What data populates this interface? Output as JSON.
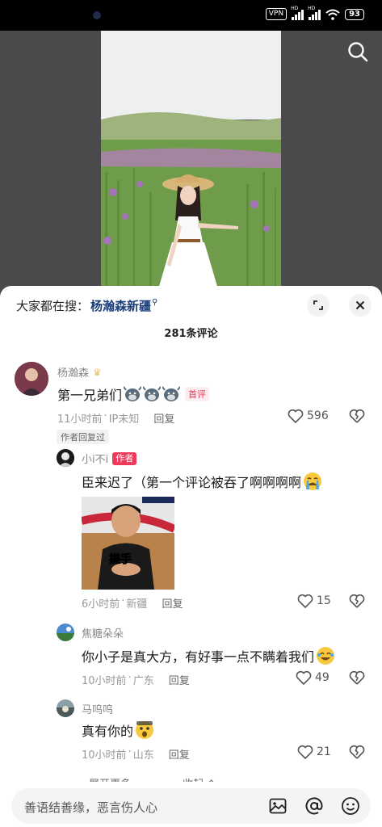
{
  "status_bar": {
    "vpn": "VPN",
    "signal_label": "HD",
    "battery": "93"
  },
  "panel": {
    "hot_search_prefix": "大家都在搜：",
    "hot_search_keyword": "杨瀚森新疆",
    "comment_count": "281条评论"
  },
  "comments": [
    {
      "user": "杨瀚森",
      "text": "第一兄弟们",
      "badge": "首评",
      "time": "11小时前",
      "location": "IP未知",
      "reply": "回复",
      "likes": "596",
      "author_replied": "作者回复过"
    },
    {
      "user": "小i不i",
      "author_tag": "作者",
      "text": "臣来迟了（第一个评论被吞了啊啊啊啊",
      "meme_caption": "搓手",
      "time": "6小时前",
      "location": "新疆",
      "reply": "回复",
      "likes": "15"
    },
    {
      "user": "焦糖朵朵",
      "text": "你小子是真大方，有好事一点不瞒着我们",
      "time": "10小时前",
      "location": "广东",
      "reply": "回复",
      "likes": "49"
    },
    {
      "user": "马呜呜",
      "text": "真有你的",
      "time": "10小时前",
      "location": "山东",
      "reply": "回复",
      "likes": "21"
    }
  ],
  "more": {
    "expand": "展开更多",
    "collapse": "收起"
  },
  "input": {
    "placeholder": "善语结善缘，恶言伤人心"
  },
  "icons": {
    "search": "search-icon",
    "expand": "expand-icon",
    "close": "close-icon",
    "like": "heart-icon",
    "dislike": "broken-heart-icon",
    "image": "image-icon",
    "mention": "at-icon",
    "emoji": "emoji-icon"
  },
  "colors": {
    "accent": "#ee3a5a",
    "keyword": "#1b3f7a"
  }
}
